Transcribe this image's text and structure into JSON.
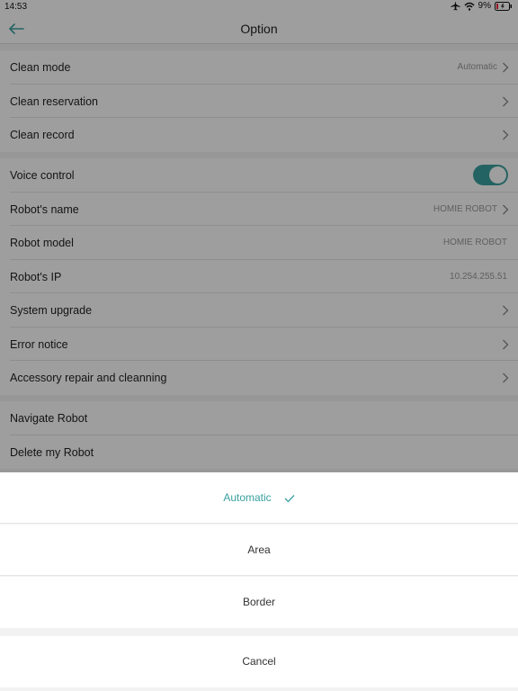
{
  "status": {
    "time": "14:53",
    "battery": "9%"
  },
  "nav": {
    "title": "Option"
  },
  "section1": [
    {
      "label": "Clean mode",
      "value": "Automatic"
    },
    {
      "label": "Clean reservation"
    },
    {
      "label": "Clean record"
    }
  ],
  "section2": [
    {
      "label": "Voice control",
      "toggle_on": true
    },
    {
      "label": "Robot's name",
      "value": "HOMIE ROBOT"
    },
    {
      "label": "Robot model",
      "value": "HOMIE ROBOT"
    },
    {
      "label": "Robot's IP",
      "value": "10.254.255.51"
    },
    {
      "label": "System upgrade"
    },
    {
      "label": "Error notice"
    },
    {
      "label": "Accessory repair and cleanning"
    }
  ],
  "section3": [
    {
      "label": "Navigate Robot"
    },
    {
      "label": "Delete my Robot"
    }
  ],
  "sheet": {
    "options": [
      "Automatic",
      "Area",
      "Border"
    ],
    "selected": "Automatic",
    "cancel": "Cancel"
  },
  "colors": {
    "accent": "#3aa0a0"
  }
}
